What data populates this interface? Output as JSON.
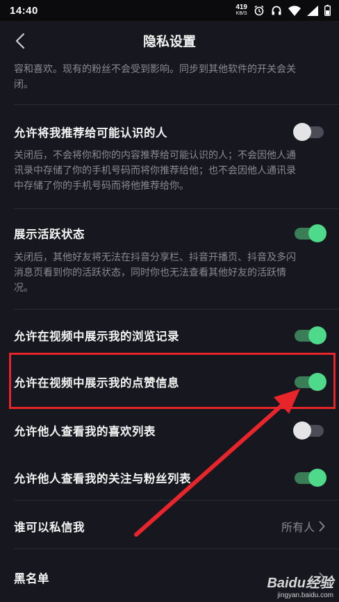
{
  "status_bar": {
    "time": "14:40",
    "net_speed": "419",
    "net_unit": "KB/S",
    "icons": [
      "alarm-icon",
      "headphones-icon",
      "wifi-icon",
      "signal-icon",
      "battery-icon"
    ]
  },
  "nav": {
    "title": "隐私设置",
    "back_icon": "chevron-left-icon"
  },
  "top_desc": {
    "line1": "容和喜欢。现有的粉丝不会受到影响。同步到其他软件的开关会关",
    "line2": "闭。"
  },
  "settings": {
    "recommend": {
      "label": "允许将我推荐给可能认识的人",
      "enabled": false,
      "desc1": "关闭后，不会将你和你的内容推荐给可能认识的人；不会因他人通",
      "desc2": "讯录中存储了你的手机号码而将你推荐给他；也不会因他人通讯录",
      "desc3": "中存储了你的手机号码而将他推荐给你。"
    },
    "active_status": {
      "label": "展示活跃状态",
      "enabled": true,
      "desc1": "关闭后，其他好友将无法在抖音分享栏、抖音开播页、抖音及多闪",
      "desc2": "消息页看到你的活跃状态，同时你也无法查看其他好友的活跃情",
      "desc3": "况。"
    },
    "browse_history": {
      "label": "允许在视频中展示我的浏览记录",
      "enabled": true
    },
    "like_info": {
      "label": "允许在视频中展示我的点赞信息",
      "enabled": true
    },
    "like_list": {
      "label": "允许他人查看我的喜欢列表",
      "enabled": false
    },
    "follow_list": {
      "label": "允许他人查看我的关注与粉丝列表",
      "enabled": true
    },
    "private_message": {
      "label": "谁可以私信我",
      "value": "所有人"
    },
    "blacklist": {
      "label": "黑名单"
    }
  },
  "colors": {
    "background": "#17181f",
    "toggle_on": "#4fd98a",
    "toggle_off": "#e4e4e6",
    "annotation": "#e8252b"
  },
  "watermark": {
    "brand": "Baidu经验",
    "site": "jingyan.baidu.com"
  }
}
